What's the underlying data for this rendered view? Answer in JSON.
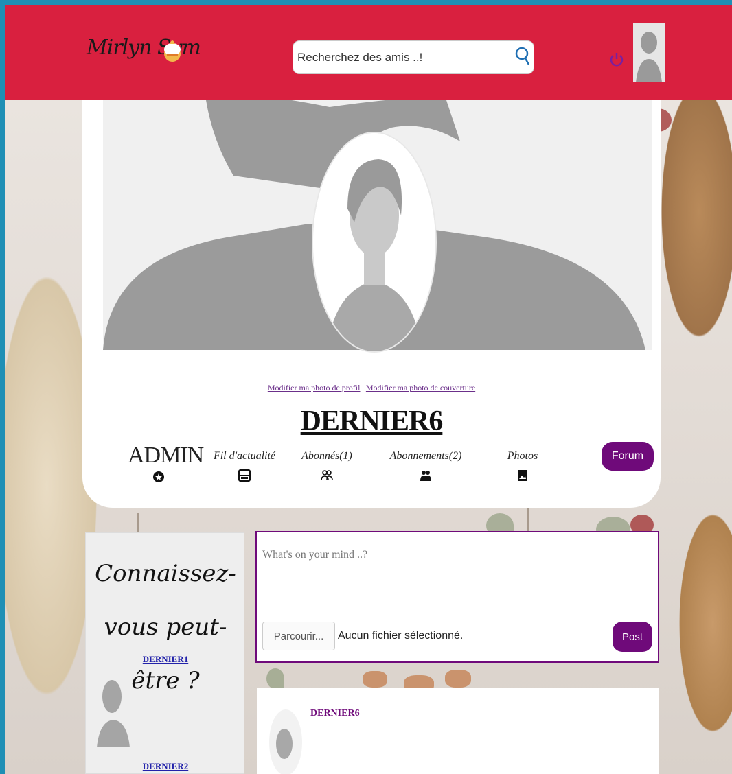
{
  "app": {
    "logo_text": "Mirlyn Sym"
  },
  "search": {
    "placeholder": "Recherchez des amis ..!"
  },
  "profile": {
    "edit_profile_photo": "Modifier ma photo de profil",
    "separator": "|",
    "edit_cover_photo": "Modifier ma photo de couverture",
    "name": "DERNIER6"
  },
  "nav": {
    "admin": {
      "label": "ADMIN",
      "icon": "star-circle-icon"
    },
    "feed": {
      "label": "Fil d'actualité",
      "icon": "newspaper-icon"
    },
    "followers": {
      "label": "Abonnés(1)",
      "icon": "users-outline-icon"
    },
    "following": {
      "label": "Abonnements(2)",
      "icon": "users-solid-icon"
    },
    "photos": {
      "label": "Photos",
      "icon": "photo-icon"
    },
    "forum": "Forum"
  },
  "suggestions": {
    "title": "Connaissez-vous peut-être ?",
    "people": [
      {
        "name": "DERNIER1"
      },
      {
        "name": "DERNIER2"
      }
    ]
  },
  "composer": {
    "placeholder": "What's on your mind ..?",
    "browse_label": "Parcourir...",
    "file_status": "Aucun fichier sélectionné.",
    "post_label": "Post"
  },
  "feed": {
    "posts": [
      {
        "author": "DERNIER6"
      }
    ]
  },
  "colors": {
    "header": "#d9203f",
    "accent": "#6f0a7a",
    "link": "#2222aa"
  }
}
